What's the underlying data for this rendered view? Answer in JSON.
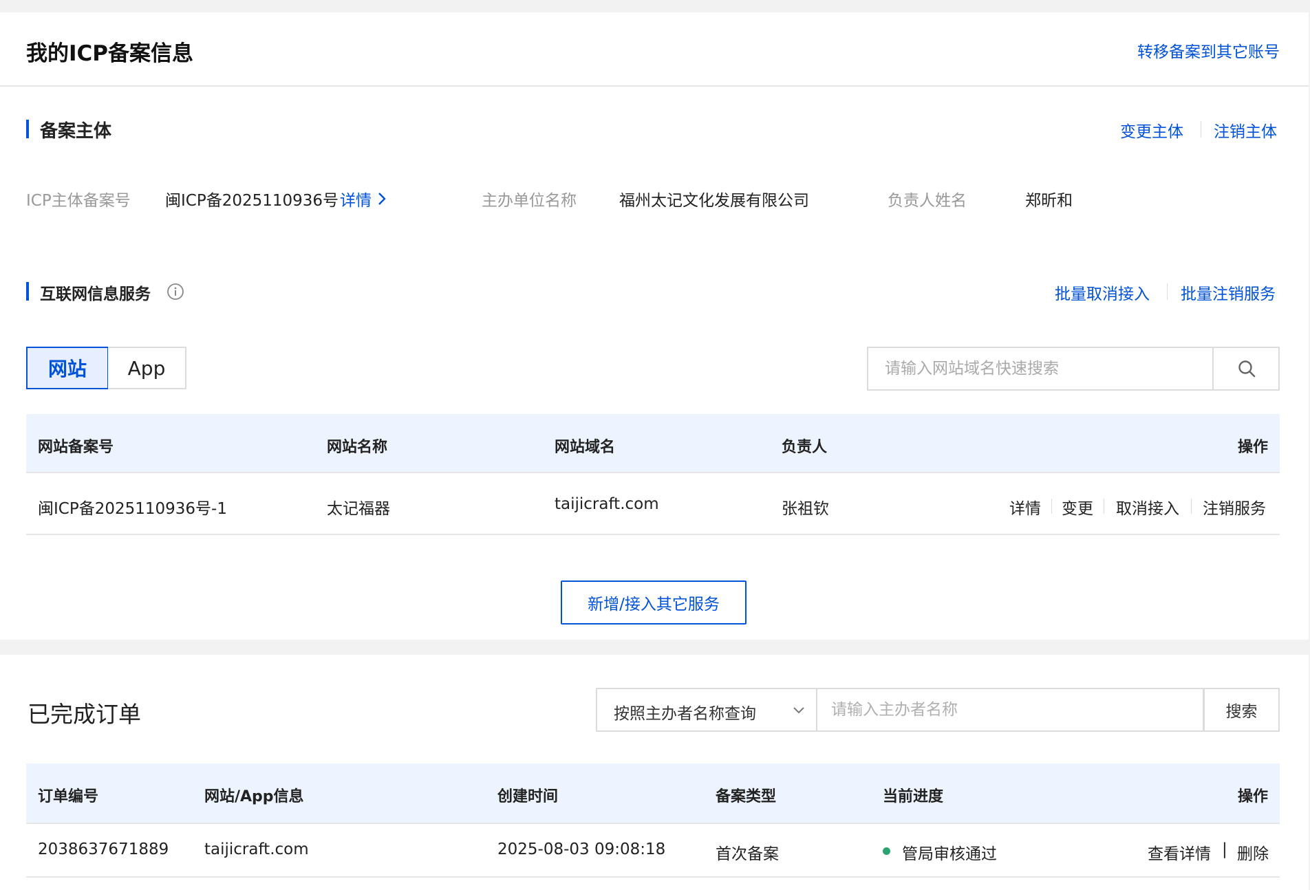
{
  "header": {
    "title": "我的ICP备案信息",
    "transfer_link": "转移备案到其它账号"
  },
  "subject": {
    "title": "备案主体",
    "actions": {
      "change": "变更主体",
      "cancel": "注销主体"
    },
    "fields": {
      "icp_label": "ICP主体备案号",
      "icp_value": "闽ICP备2025110936号",
      "detail_link": "详情",
      "org_label": "主办单位名称",
      "org_value": "福州太记文化发展有限公司",
      "person_label": "负责人姓名",
      "person_value": "郑昕和"
    }
  },
  "internet_service": {
    "title": "互联网信息服务",
    "actions": {
      "batch_unlink": "批量取消接入",
      "batch_cancel": "批量注销服务"
    },
    "tabs": {
      "website": "网站",
      "app": "App"
    },
    "search_placeholder": "请输入网站域名快速搜索",
    "table": {
      "headers": {
        "record_no": "网站备案号",
        "name": "网站名称",
        "domain": "网站域名",
        "owner": "负责人",
        "ops": "操作"
      },
      "rows": [
        {
          "record_no": "闽ICP备2025110936号-1",
          "name": "太记福器",
          "domain": "taijicraft.com",
          "owner": "张祖钦",
          "ops": {
            "detail": "详情",
            "change": "变更",
            "unlink": "取消接入",
            "cancel": "注销服务"
          }
        }
      ]
    },
    "add_button": "新增/接入其它服务"
  },
  "orders": {
    "title": "已完成订单",
    "filter_select": "按照主办者名称查询",
    "search_placeholder": "请输入主办者名称",
    "search_button": "搜索",
    "table": {
      "headers": {
        "order_no": "订单编号",
        "info": "网站/App信息",
        "created": "创建时间",
        "type": "备案类型",
        "progress": "当前进度",
        "ops": "操作"
      },
      "rows": [
        {
          "order_no": "2038637671889",
          "info": "taijicraft.com",
          "created": "2025-08-03 09:08:18",
          "type": "首次备案",
          "progress": "管局审核通过",
          "ops": {
            "view": "查看详情",
            "sep": "|",
            "delete": "删除"
          }
        }
      ]
    }
  },
  "colors": {
    "accent": "#0052d9",
    "success": "#2ba471",
    "header_bg": "#eef4ff"
  },
  "icons": {
    "info": "info-circle-icon",
    "search": "search-icon",
    "chevron_right": "chevron-right-icon",
    "chevron_down": "chevron-down-icon"
  }
}
